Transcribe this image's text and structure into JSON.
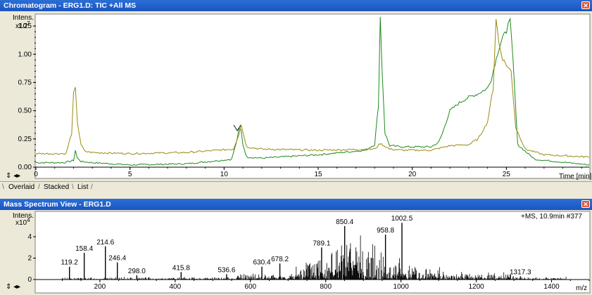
{
  "chromatogram_window": {
    "title": "Chromatogram - ERG1.D: TIC +All MS",
    "close_glyph": "✕",
    "y_label_line1": "Intens.",
    "y_label_line2": "x10",
    "y_exponent": "7",
    "x_label": "Time [min]",
    "tabs": [
      "Overlaid",
      "Stacked",
      "List"
    ]
  },
  "spectrum_window": {
    "title": "Mass Spectrum View - ERG1.D",
    "close_glyph": "✕",
    "y_label_line1": "Intens.",
    "y_label_line2": "x10",
    "y_exponent": "4",
    "x_label": "m/z",
    "scan_info": "+MS, 10.9min #377"
  },
  "colors": {
    "green": "#1e8a1e",
    "olive": "#9a8a10",
    "titlebar": "#1c55c0"
  },
  "chart_data": [
    {
      "type": "line",
      "xlabel": "Time [min]",
      "ylabel": "Intens. x10^7",
      "xlim": [
        0,
        29.4
      ],
      "ylim": [
        0,
        1.35
      ],
      "xticks": [
        0,
        5,
        10,
        15,
        20,
        25
      ],
      "yticks": [
        "0.00",
        "0.25",
        "0.50",
        "0.75",
        "1.00",
        "1.25"
      ],
      "series": [
        {
          "color": "#1e8a1e",
          "x": [
            0,
            1.5,
            2.0,
            2.1,
            2.2,
            2.4,
            3.0,
            5.0,
            8.0,
            10.4,
            10.7,
            10.8,
            10.9,
            11.0,
            11.2,
            12.0,
            15.0,
            17.5,
            18.0,
            18.2,
            18.3,
            18.4,
            18.55,
            18.8,
            19.5,
            21.0,
            21.4,
            21.6,
            21.8,
            22.0,
            22.5,
            23.0,
            23.5,
            24.0,
            24.2,
            24.4,
            24.6,
            24.8,
            25.0,
            25.1,
            25.2,
            25.35,
            25.6,
            26.5,
            29.4
          ],
          "y": [
            0.04,
            0.04,
            0.06,
            0.15,
            0.08,
            0.05,
            0.04,
            0.02,
            0.03,
            0.07,
            0.25,
            0.34,
            0.33,
            0.2,
            0.09,
            0.08,
            0.11,
            0.15,
            0.2,
            0.55,
            1.33,
            0.85,
            0.3,
            0.19,
            0.18,
            0.18,
            0.22,
            0.3,
            0.4,
            0.5,
            0.57,
            0.62,
            0.65,
            0.7,
            0.78,
            0.92,
            1.05,
            1.15,
            1.2,
            1.3,
            1.3,
            0.95,
            0.2,
            0.07,
            0.02
          ]
        },
        {
          "color": "#9a8a10",
          "x": [
            0,
            1.6,
            1.9,
            2.0,
            2.1,
            2.2,
            2.4,
            2.6,
            3.0,
            5.0,
            8.0,
            10.5,
            10.8,
            10.9,
            11.2,
            12.0,
            15.0,
            18.0,
            18.3,
            18.5,
            18.8,
            19.5,
            21.0,
            21.5,
            22.0,
            23.0,
            23.5,
            24.0,
            24.3,
            24.45,
            24.6,
            24.8,
            25.1,
            25.25,
            25.5,
            26.0,
            27.0,
            29.4
          ],
          "y": [
            0.12,
            0.12,
            0.3,
            0.65,
            0.7,
            0.4,
            0.2,
            0.14,
            0.13,
            0.12,
            0.13,
            0.16,
            0.3,
            0.38,
            0.18,
            0.16,
            0.15,
            0.16,
            0.21,
            0.19,
            0.16,
            0.15,
            0.15,
            0.17,
            0.19,
            0.2,
            0.25,
            0.4,
            0.7,
            1.32,
            1.1,
            0.96,
            0.88,
            0.85,
            0.35,
            0.16,
            0.11,
            0.09
          ]
        }
      ]
    },
    {
      "type": "bar",
      "xlabel": "m/z",
      "ylabel": "Intens. x10^4",
      "xlim": [
        30,
        1500
      ],
      "ylim": [
        0,
        6.3
      ],
      "xticks": [
        200,
        400,
        600,
        800,
        1000,
        1200,
        1400
      ],
      "yticks": [
        "0",
        "2",
        "4"
      ],
      "labeled_peaks": [
        {
          "mz": 119.2,
          "label": "119.2",
          "intensity": 1.2
        },
        {
          "mz": 158.4,
          "label": "158.4",
          "intensity": 2.5
        },
        {
          "mz": 214.6,
          "label": "214.6",
          "intensity": 3.1
        },
        {
          "mz": 246.4,
          "label": "246.4",
          "intensity": 1.6
        },
        {
          "mz": 298.0,
          "label": "298.0",
          "intensity": 0.4
        },
        {
          "mz": 415.8,
          "label": "415.8",
          "intensity": 0.7
        },
        {
          "mz": 536.6,
          "label": "536.6",
          "intensity": 0.5
        },
        {
          "mz": 630.4,
          "label": "630.4",
          "intensity": 1.2
        },
        {
          "mz": 678.2,
          "label": "678.2",
          "intensity": 1.5
        },
        {
          "mz": 789.1,
          "label": "789.1",
          "intensity": 3.0
        },
        {
          "mz": 850.4,
          "label": "850.4",
          "intensity": 5.0
        },
        {
          "mz": 958.8,
          "label": "958.8",
          "intensity": 4.2
        },
        {
          "mz": 1002.5,
          "label": "1002.5",
          "intensity": 5.3
        },
        {
          "mz": 1317.3,
          "label": "1317.3",
          "intensity": 0.3
        }
      ]
    }
  ]
}
